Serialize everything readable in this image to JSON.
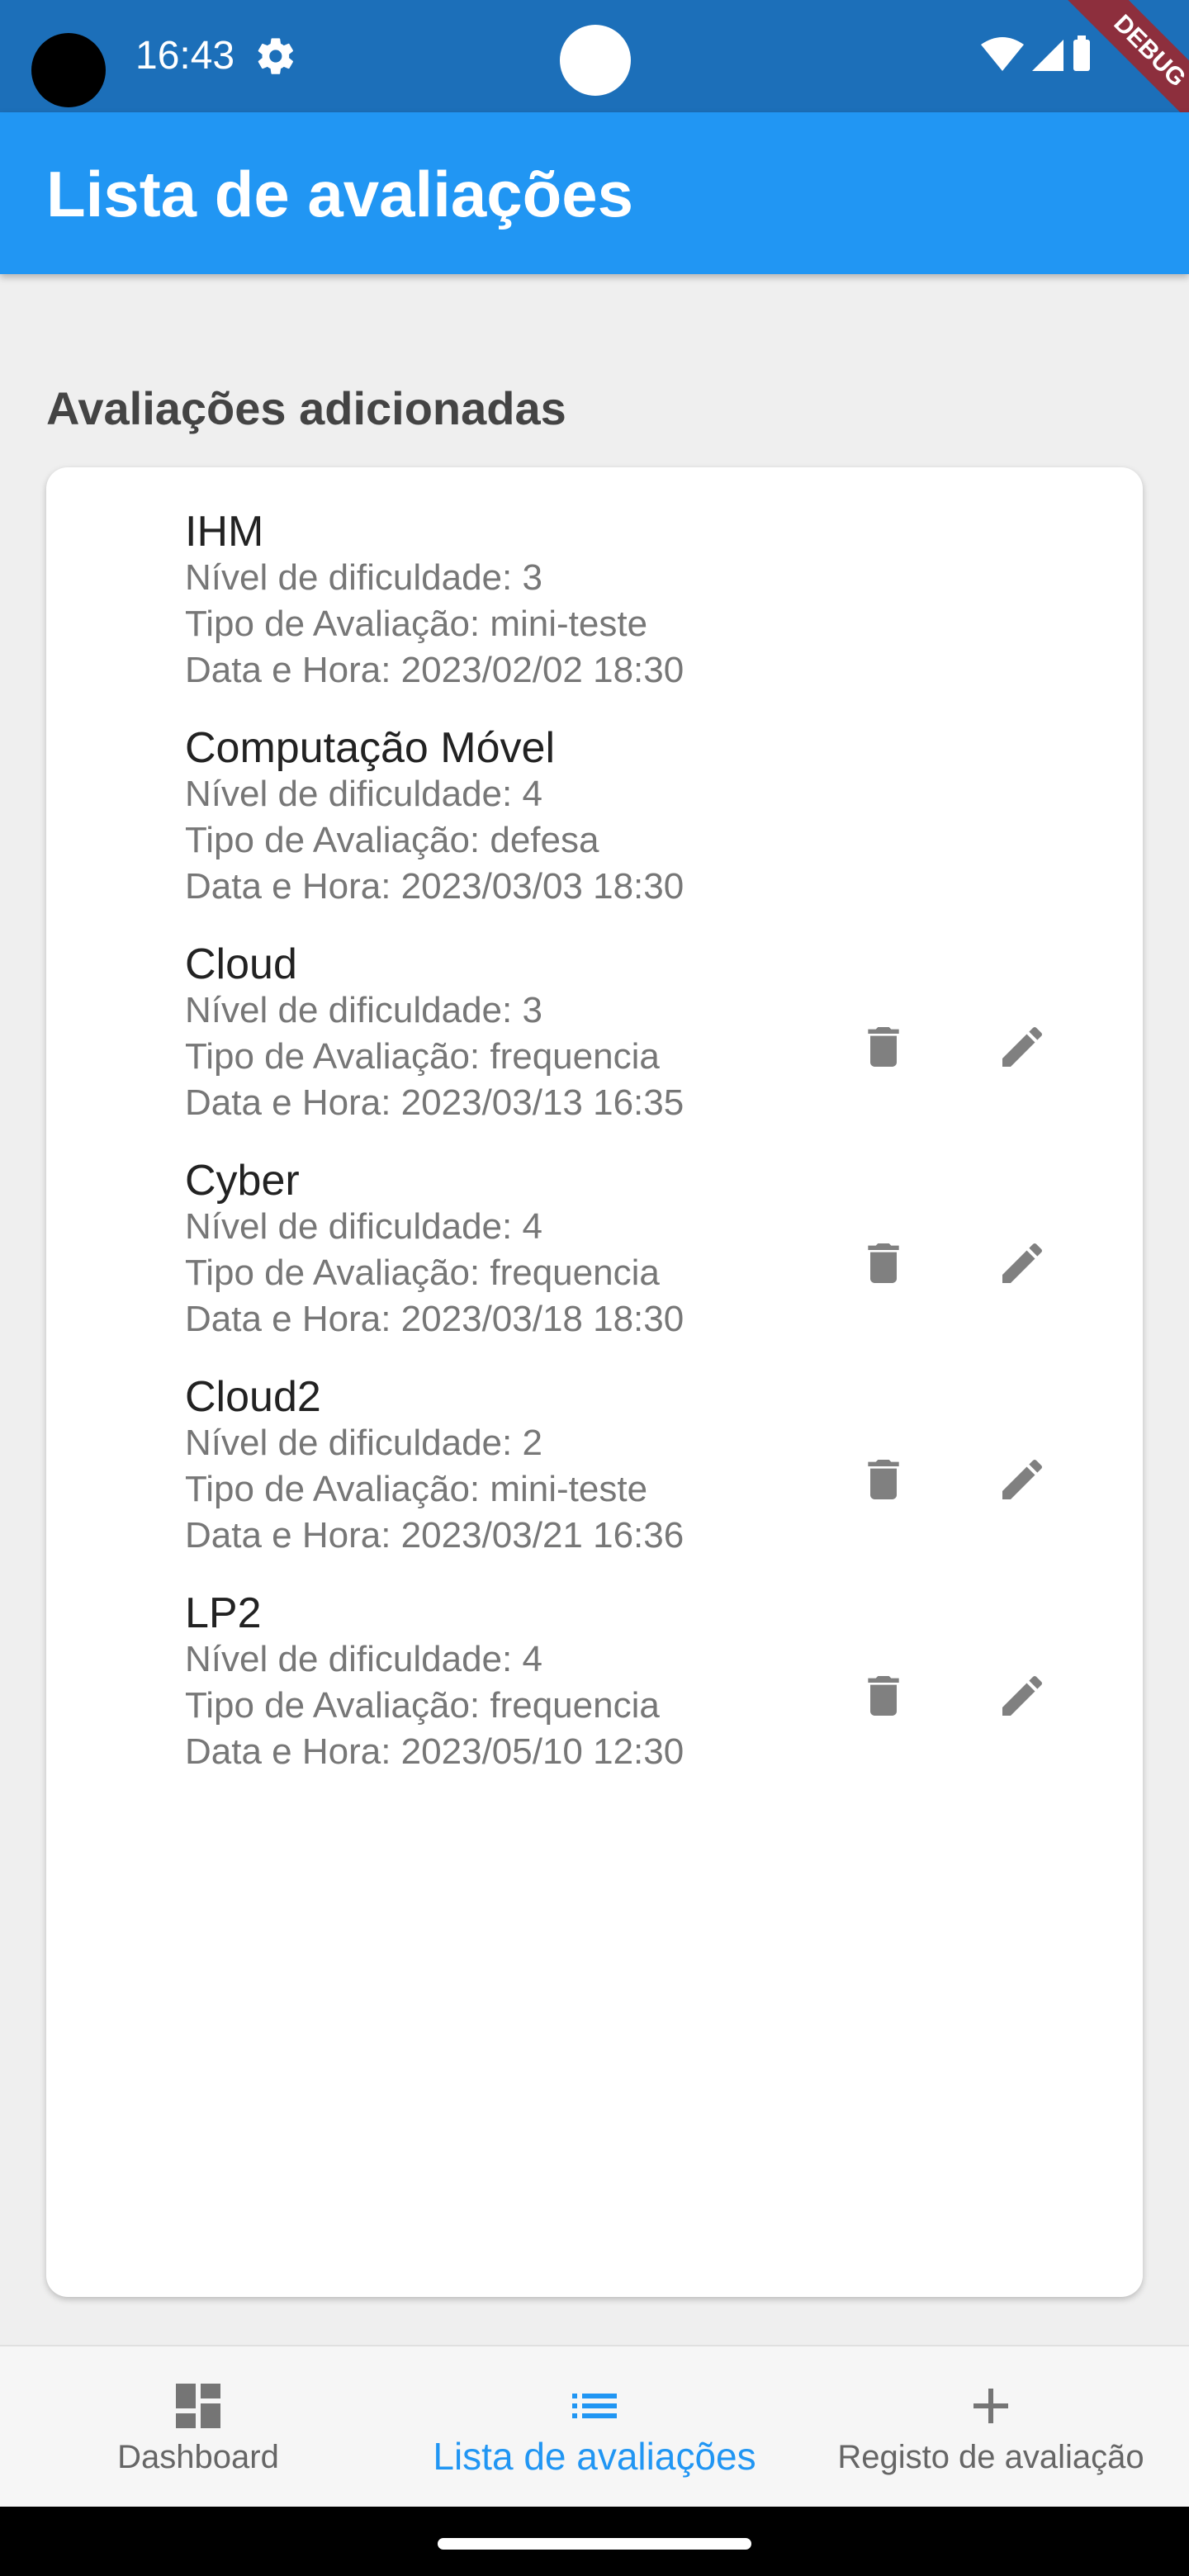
{
  "status_bar": {
    "time": "16:43",
    "debug_label": "DEBUG",
    "icons": [
      "camera-icon",
      "gear-icon",
      "wifi-icon",
      "signal-icon",
      "battery-icon"
    ]
  },
  "app_bar": {
    "title": "Lista de avaliações",
    "color": "#2196f3"
  },
  "section_title": "Avaliações adicionadas",
  "evaluations": [
    {
      "title": "IHM",
      "difficulty": "Nível de dificuldade: 3",
      "type": "Tipo de Avaliação: mini-teste",
      "datetime": "Data e Hora: 2023/02/02 18:30",
      "actions": false
    },
    {
      "title": "Computação Móvel",
      "difficulty": "Nível de dificuldade: 4",
      "type": "Tipo de Avaliação: defesa",
      "datetime": "Data e Hora: 2023/03/03 18:30",
      "actions": false
    },
    {
      "title": "Cloud",
      "difficulty": "Nível de dificuldade: 3",
      "type": "Tipo de Avaliação: frequencia",
      "datetime": "Data e Hora: 2023/03/13 16:35",
      "actions": true
    },
    {
      "title": "Cyber",
      "difficulty": "Nível de dificuldade: 4",
      "type": "Tipo de Avaliação: frequencia",
      "datetime": "Data e Hora: 2023/03/18 18:30",
      "actions": true
    },
    {
      "title": "Cloud2",
      "difficulty": "Nível de dificuldade: 2",
      "type": "Tipo de Avaliação: mini-teste",
      "datetime": "Data e Hora: 2023/03/21 16:36",
      "actions": true
    },
    {
      "title": "LP2",
      "difficulty": "Nível de dificuldade: 4",
      "type": "Tipo de Avaliação: frequencia",
      "datetime": "Data e Hora: 2023/05/10 12:30",
      "actions": true
    }
  ],
  "bottom_nav": {
    "items": [
      {
        "label": "Dashboard",
        "icon": "dashboard-icon",
        "active": false
      },
      {
        "label": "Lista de avaliações",
        "icon": "list-icon",
        "active": true
      },
      {
        "label": "Registo de avaliação",
        "icon": "add-icon",
        "active": false
      }
    ],
    "active_color": "#2196f3"
  }
}
